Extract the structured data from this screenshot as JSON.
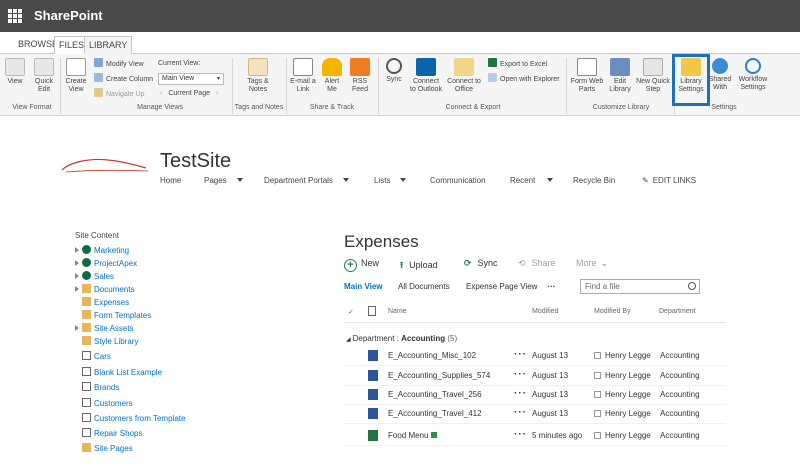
{
  "suitebar": {
    "brand": "SharePoint"
  },
  "ribbon_tabs": [
    {
      "label": "BROWSE"
    },
    {
      "label": "FILES"
    },
    {
      "label": "LIBRARY"
    }
  ],
  "ribbon": {
    "view_format": {
      "label": "View Format",
      "buttons": [
        {
          "label": "View"
        },
        {
          "label": "Quick Edit"
        }
      ]
    },
    "manage_views": {
      "label": "Manage Views",
      "create_view": "Create View",
      "modify_view": "Modify View",
      "create_column": "Create Column",
      "navigate_up": "Navigate Up",
      "current_view_label": "Current View:",
      "current_view_value": "Main View",
      "current_page": "Current Page"
    },
    "tags_notes": {
      "label": "Tags and Notes",
      "button": "Tags & Notes"
    },
    "share_track": {
      "label": "Share & Track",
      "buttons": [
        {
          "label": "E-mail a Link"
        },
        {
          "label": "Alert Me"
        },
        {
          "label": "RSS Feed"
        }
      ]
    },
    "connect_export": {
      "label": "Connect & Export",
      "buttons": [
        {
          "label": "Sync"
        },
        {
          "label": "Connect to Outlook"
        },
        {
          "label": "Connect to Office"
        }
      ],
      "export_excel": "Export to Excel",
      "open_explorer": "Open with Explorer"
    },
    "customize_library": {
      "label": "Customize Library",
      "buttons": [
        {
          "label": "Form Web Parts"
        },
        {
          "label": "Edit Library"
        },
        {
          "label": "New Quick Step"
        }
      ]
    },
    "settings": {
      "label": "Settings",
      "buttons": [
        {
          "label": "Library Settings"
        },
        {
          "label": "Shared With"
        },
        {
          "label": "Workflow Settings"
        }
      ]
    }
  },
  "site": {
    "title": "TestSite",
    "nav": [
      {
        "label": "Home"
      },
      {
        "label": "Pages"
      },
      {
        "label": "Department Portals"
      },
      {
        "label": "Lists"
      },
      {
        "label": "Communication"
      },
      {
        "label": "Recent"
      },
      {
        "label": "Recycle Bin"
      },
      {
        "label": "EDIT LINKS"
      }
    ]
  },
  "leftnav": {
    "heading": "Site Content",
    "items": [
      {
        "label": "Marketing"
      },
      {
        "label": "ProjectApex"
      },
      {
        "label": "Sales"
      },
      {
        "label": "Documents"
      },
      {
        "label": "Expenses"
      },
      {
        "label": "Form Templates"
      },
      {
        "label": "Site Assets"
      },
      {
        "label": "Style Library"
      },
      {
        "label": "Cars"
      },
      {
        "label": "Blank List Example"
      },
      {
        "label": "Brands"
      },
      {
        "label": "Customers"
      },
      {
        "label": "Customers from Template"
      },
      {
        "label": "Repair Shops"
      },
      {
        "label": "Site Pages"
      }
    ]
  },
  "list": {
    "title": "Expenses",
    "commands": {
      "new": "New",
      "upload": "Upload",
      "sync": "Sync",
      "share": "Share",
      "more": "More"
    },
    "views": [
      {
        "label": "Main View"
      },
      {
        "label": "All Documents"
      },
      {
        "label": "Expense Page View"
      }
    ],
    "search_placeholder": "Find a file",
    "columns": {
      "name": "Name",
      "modified": "Modified",
      "modified_by": "Modified By",
      "department": "Department"
    },
    "group": {
      "prefix": "Department : ",
      "name": "Accounting",
      "count": "(5)"
    },
    "rows": [
      {
        "name": "E_Accounting_Misc_102",
        "modified": "August 13",
        "modified_by": "Henry Legge",
        "department": "Accounting"
      },
      {
        "name": "E_Accounting_Supplies_574",
        "modified": "August 13",
        "modified_by": "Henry Legge",
        "department": "Accounting"
      },
      {
        "name": "E_Accounting_Travel_256",
        "modified": "August 13",
        "modified_by": "Henry Legge",
        "department": "Accounting"
      },
      {
        "name": "E_Accounting_Travel_412",
        "modified": "August 13",
        "modified_by": "Henry Legge",
        "department": "Accounting"
      },
      {
        "name": "Food Menu",
        "modified": "5 minutes ago",
        "modified_by": "Henry Legge",
        "department": "Accounting"
      }
    ]
  },
  "colors": {
    "suitebar": "#4a4a4a",
    "link": "#0072c6",
    "highlight": "#1f6fbf",
    "word": "#2b579a",
    "excel": "#217346"
  }
}
